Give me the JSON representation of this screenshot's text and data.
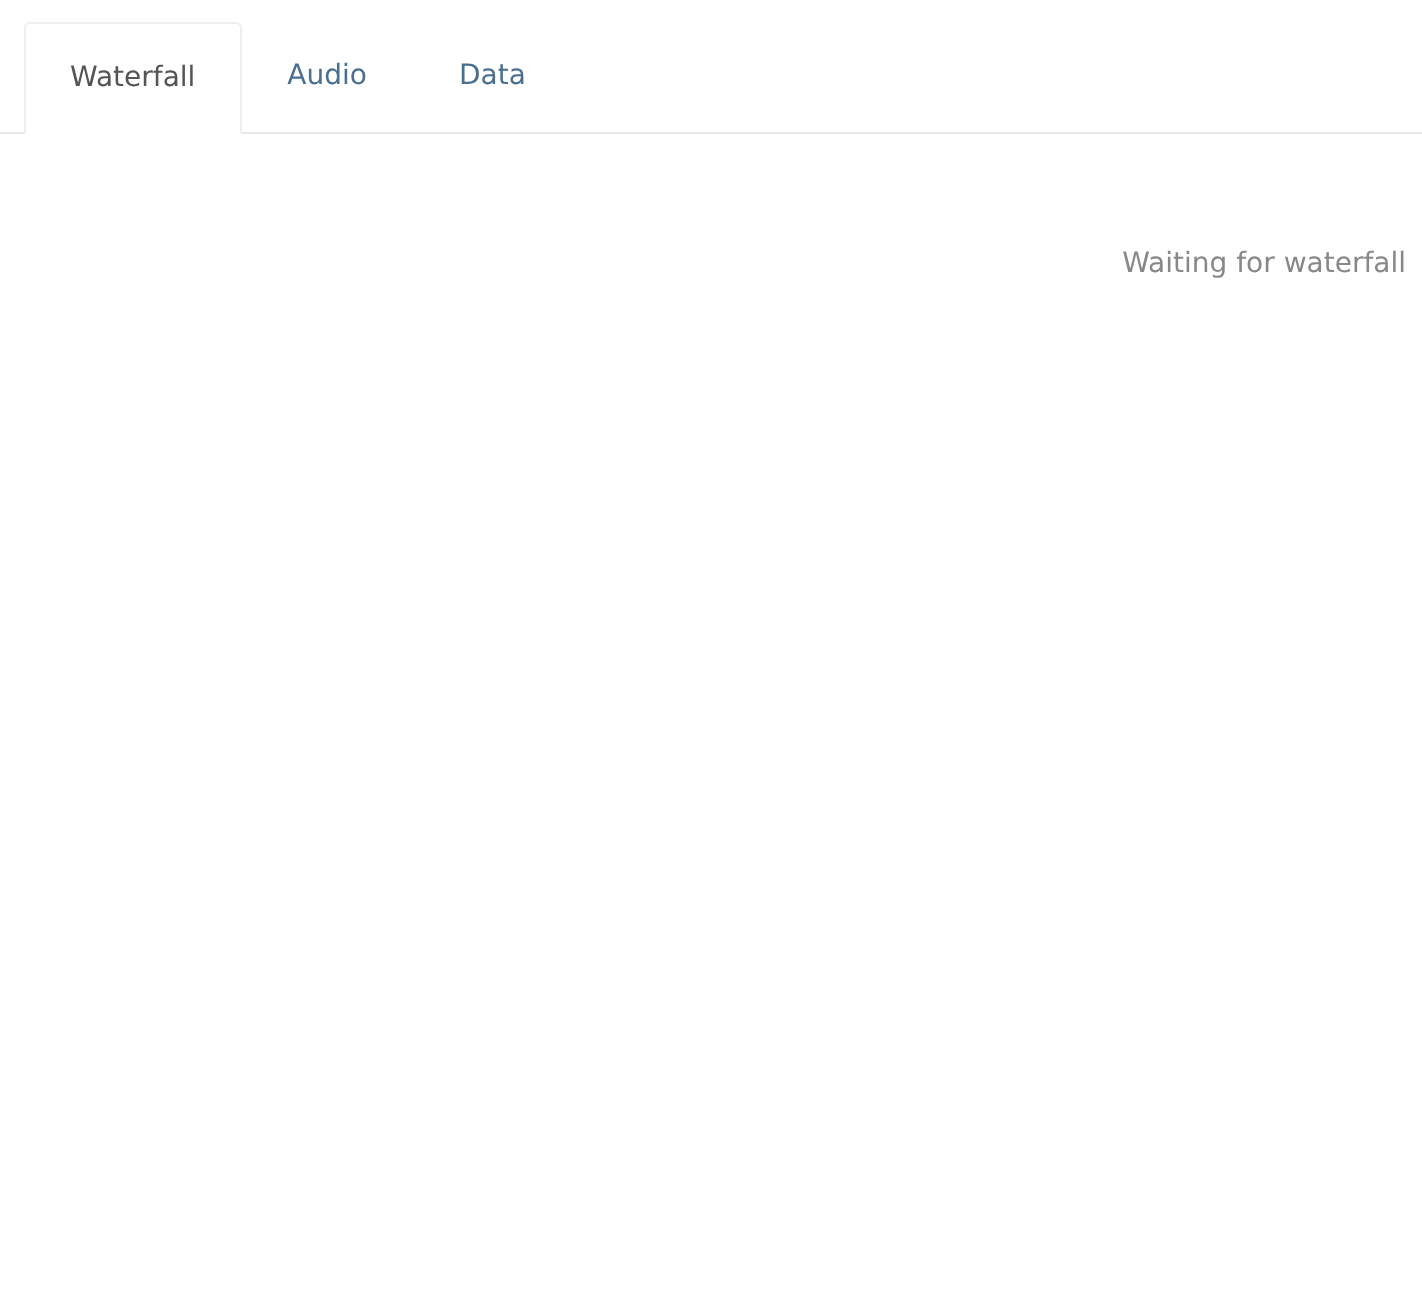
{
  "tabs": [
    {
      "label": "Waterfall",
      "selected": true
    },
    {
      "label": "Audio",
      "selected": false
    },
    {
      "label": "Data",
      "selected": false
    }
  ],
  "status": "Waiting for waterfall"
}
